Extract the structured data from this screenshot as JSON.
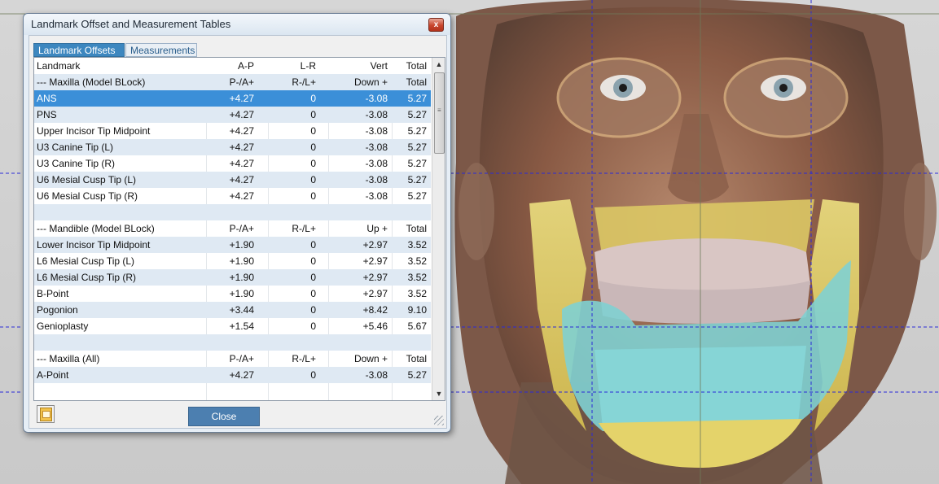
{
  "window": {
    "title": "Landmark Offset and Measurement Tables",
    "close_glyph": "x"
  },
  "tabs": [
    {
      "label": "Landmark Offsets",
      "active": true
    },
    {
      "label": "Measurements",
      "active": false
    }
  ],
  "table": {
    "columns": [
      "Landmark",
      "A-P",
      "L-R",
      "Vert",
      "Total"
    ],
    "rows": [
      {
        "cells": [
          "--- Maxilla (Model BLock)",
          "P-/A+",
          "R-/L+",
          "Down +",
          "Total"
        ],
        "kind": "group"
      },
      {
        "cells": [
          "ANS",
          "+4.27",
          "0",
          "-3.08",
          "5.27"
        ],
        "kind": "selected"
      },
      {
        "cells": [
          "PNS",
          "+4.27",
          "0",
          "-3.08",
          "5.27"
        ],
        "kind": "data"
      },
      {
        "cells": [
          "Upper Incisor Tip Midpoint",
          "+4.27",
          "0",
          "-3.08",
          "5.27"
        ],
        "kind": "data"
      },
      {
        "cells": [
          "U3 Canine Tip (L)",
          "+4.27",
          "0",
          "-3.08",
          "5.27"
        ],
        "kind": "data"
      },
      {
        "cells": [
          "U3 Canine Tip (R)",
          "+4.27",
          "0",
          "-3.08",
          "5.27"
        ],
        "kind": "data"
      },
      {
        "cells": [
          "U6 Mesial Cusp Tip (L)",
          "+4.27",
          "0",
          "-3.08",
          "5.27"
        ],
        "kind": "data"
      },
      {
        "cells": [
          "U6 Mesial Cusp Tip (R)",
          "+4.27",
          "0",
          "-3.08",
          "5.27"
        ],
        "kind": "data"
      },
      {
        "cells": [
          "",
          "",
          "",
          "",
          ""
        ],
        "kind": "blank"
      },
      {
        "cells": [
          "--- Mandible (Model BLock)",
          "P-/A+",
          "R-/L+",
          "Up +",
          "Total"
        ],
        "kind": "group"
      },
      {
        "cells": [
          "Lower Incisor Tip Midpoint",
          "+1.90",
          "0",
          "+2.97",
          "3.52"
        ],
        "kind": "data"
      },
      {
        "cells": [
          "L6 Mesial Cusp Tip (L)",
          "+1.90",
          "0",
          "+2.97",
          "3.52"
        ],
        "kind": "data"
      },
      {
        "cells": [
          "L6 Mesial Cusp Tip (R)",
          "+1.90",
          "0",
          "+2.97",
          "3.52"
        ],
        "kind": "data"
      },
      {
        "cells": [
          "B-Point",
          "+1.90",
          "0",
          "+2.97",
          "3.52"
        ],
        "kind": "data"
      },
      {
        "cells": [
          "Pogonion",
          "+3.44",
          "0",
          "+8.42",
          "9.10"
        ],
        "kind": "data"
      },
      {
        "cells": [
          "Genioplasty",
          "+1.54",
          "0",
          "+5.46",
          "5.67"
        ],
        "kind": "data"
      },
      {
        "cells": [
          "",
          "",
          "",
          "",
          ""
        ],
        "kind": "blank"
      },
      {
        "cells": [
          "--- Maxilla (All)",
          "P-/A+",
          "R-/L+",
          "Down +",
          "Total"
        ],
        "kind": "group"
      },
      {
        "cells": [
          "A-Point",
          "+4.27",
          "0",
          "-3.08",
          "5.27"
        ],
        "kind": "data"
      }
    ]
  },
  "scrollbar": {
    "up_glyph": "▲",
    "down_glyph": "▼",
    "grip_glyph": "≡"
  },
  "footer": {
    "close_label": "Close",
    "export_icon": "export-icon"
  },
  "colors": {
    "selection": "#3b8fd8",
    "active_tab": "#3d87bf",
    "alt_row": "#dfe9f3",
    "close_button": "#4c7fb0",
    "guide_line": "#2a2ad8"
  }
}
